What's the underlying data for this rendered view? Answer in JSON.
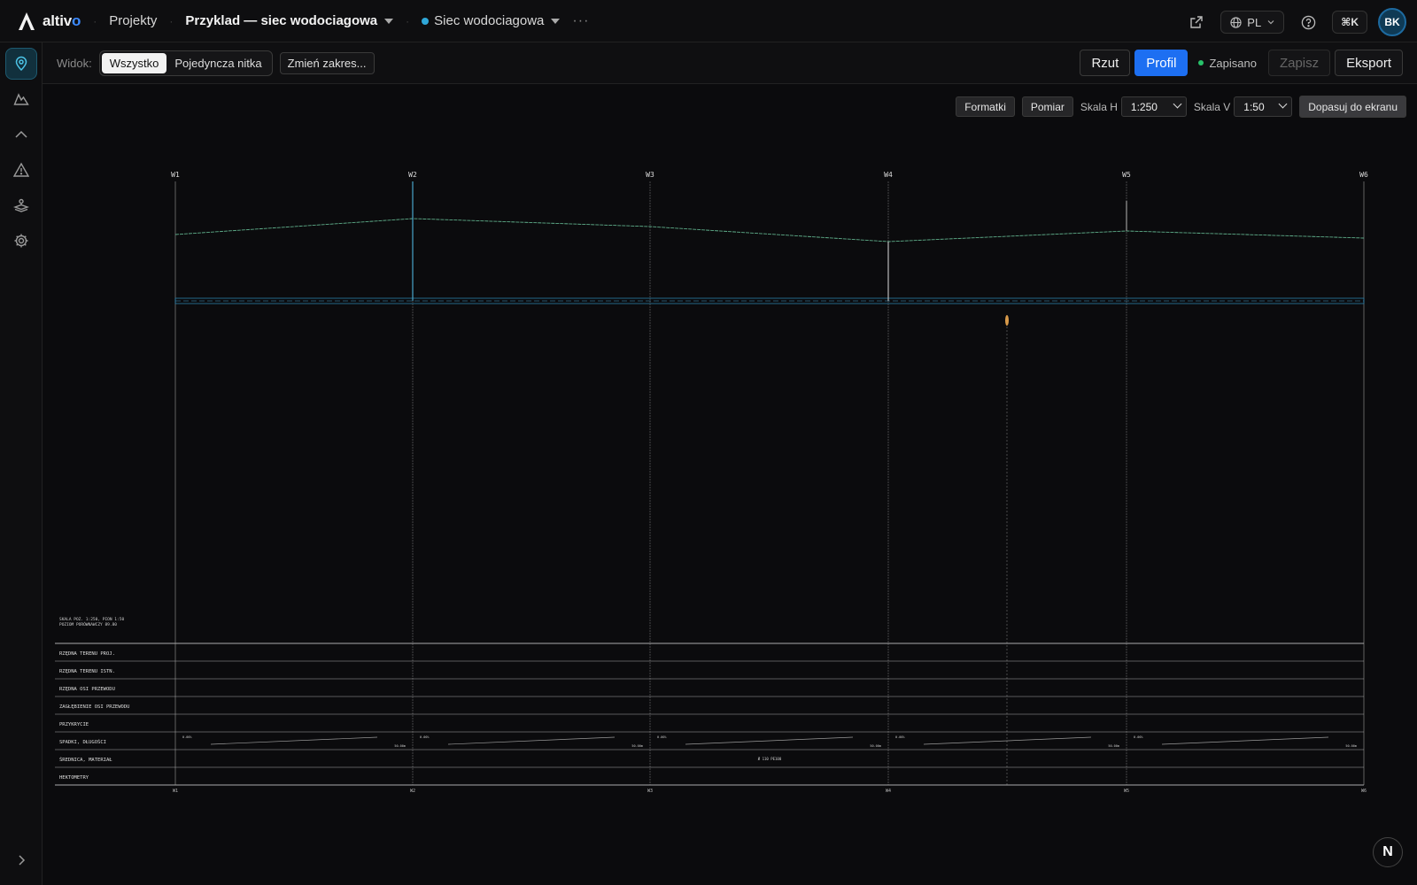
{
  "app": {
    "name_prefix": "altiv",
    "name_suffix": "o"
  },
  "breadcrumb": {
    "projects": "Projekty",
    "project": "Przyklad — siec wodociagowa",
    "network": "Siec wodociagowa",
    "more": "···"
  },
  "header": {
    "language": "PL",
    "shortcut": "⌘K",
    "avatar_initials": "BK"
  },
  "toolbar": {
    "view_label": "Widok:",
    "view_options": [
      "Wszystko",
      "Pojedyncza nitka"
    ],
    "view_selected": "Wszystko",
    "range_button": "Zmień zakres...",
    "rzut": "Rzut",
    "profil": "Profil",
    "saved_status": "Zapisano",
    "save": "Zapisz",
    "export": "Eksport"
  },
  "canvas_controls": {
    "formatki": "Formatki",
    "pomiar": "Pomiar",
    "scale_h_label": "Skala H",
    "scale_h_value": "1:250",
    "scale_v_label": "Skala V",
    "scale_v_value": "1:50",
    "fit": "Dopasuj do ekranu"
  },
  "profile": {
    "nodes": [
      "W1",
      "W2",
      "W3",
      "W4",
      "W5",
      "W6"
    ],
    "legend_lines": [
      "SKALA POZ. 1:250, PION 1:50",
      "POZIOM PORÓWNAWCZY 89.80"
    ],
    "table_rows": [
      "RZĘDNA TERENU PROJ.",
      "RZĘDNA TERENU ISTN.",
      "RZĘDNA OSI PRZEWODU",
      "ZAGŁĘBIENIE OSI PRZEWODU",
      "PRZYKRYCIE",
      "SPADKI, DŁUGOŚCI",
      "ŚREDNICA, MATERIAŁ",
      "HEKTOMETRY"
    ],
    "material": "Ø 110 PE100",
    "slopes": [
      "0.00%",
      "0.00%",
      "0.00%",
      "0.00%",
      "0.00%"
    ],
    "lengths": [
      "50.00m",
      "50.00m",
      "50.00m",
      "50.00m",
      "50.00m"
    ]
  },
  "colors": {
    "accent": "#1d6ff2",
    "terrain": "#5fae8a",
    "pipe": "#2a7fa8",
    "status_ok": "#28c26a"
  },
  "icons": [
    "map-pin-icon",
    "terrain-icon",
    "profile-icon",
    "warning-icon",
    "layers-icon",
    "settings-icon",
    "external-link-icon",
    "globe-icon",
    "help-icon",
    "expand-icon"
  ]
}
